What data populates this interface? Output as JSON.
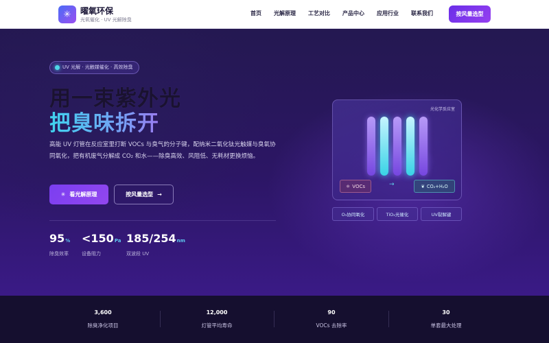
{
  "header": {
    "brand_name": "曜氧环保",
    "brand_sub": "光氧催化 · UV 光解除臭",
    "logo_icon": "✳",
    "nav": [
      "首页",
      "光解原理",
      "工艺对比",
      "产品中心",
      "应用行业",
      "联系我们"
    ],
    "cta": "按风量选型"
  },
  "hero": {
    "pill": "UV 光解 · 光触媒催化 · 高效除臭",
    "title_line1": "用一束紫外光",
    "title_line2": "把臭味拆开",
    "description": "高能 UV 灯管在反应室里打断 VOCs 与臭气的分子键，配纳米二氧化钛光触媒与臭氧协同氧化，把有机废气分解成 CO₂ 和水——除臭高效、风阻低、无耗材更换烦恼。",
    "primary_button": "看光解原理",
    "primary_icon": "✳",
    "secondary_button": "按风量选型",
    "secondary_arrow": "→",
    "stats": [
      {
        "value": "95",
        "unit": "%",
        "label": "除臭效率"
      },
      {
        "value": "<150",
        "unit": "Pa",
        "label": "设备阻力"
      },
      {
        "value": "185/254",
        "unit": "nm",
        "label": "双波段 UV"
      }
    ]
  },
  "reactor": {
    "title": "光化学反应室",
    "input_label": "VOCs",
    "output_label": "CO₂+H₂O",
    "arrow": "→",
    "features": [
      "O₃协同氧化",
      "TiO₂光催化",
      "UV裂解键"
    ]
  },
  "strip": [
    {
      "value": "3,600",
      "label": "除臭净化项目"
    },
    {
      "value": "12,000",
      "label": "灯管平均寿命"
    },
    {
      "value": "90",
      "label": "VOCs 去除率"
    },
    {
      "value": "30",
      "label": "单套最大处理"
    }
  ],
  "colors": {
    "accent_purple": "#7b3ef0",
    "accent_cyan": "#4fd7e8",
    "hero_bg": "#2c1665",
    "strip_bg": "#150f2f"
  }
}
